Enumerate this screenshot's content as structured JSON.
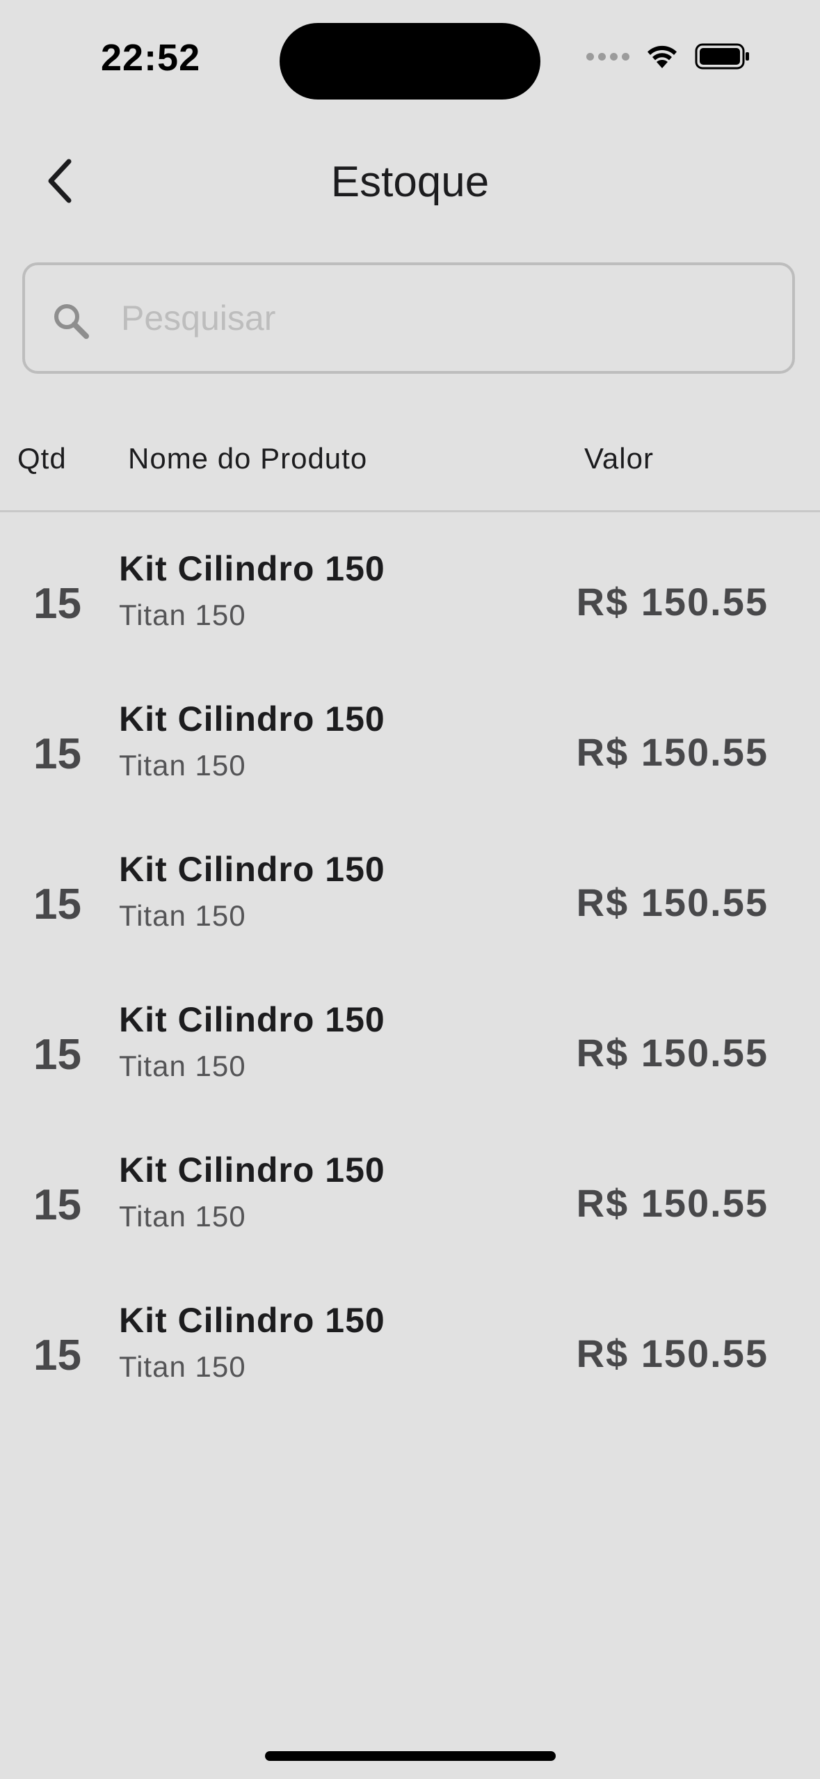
{
  "status_bar": {
    "time": "22:52",
    "icons": [
      "signal-icon",
      "wifi-icon",
      "battery-icon"
    ]
  },
  "nav": {
    "title": "Estoque",
    "back_icon": "chevron-left-icon"
  },
  "search": {
    "placeholder": "Pesquisar",
    "value": "",
    "icon": "search-icon"
  },
  "table": {
    "headers": {
      "qty": "Qtd",
      "name": "Nome do Produto",
      "value": "Valor"
    },
    "rows": [
      {
        "qty": "15",
        "name": "Kit Cilindro 150",
        "subtitle": "Titan 150",
        "value": "R$ 150.55"
      },
      {
        "qty": "15",
        "name": "Kit Cilindro 150",
        "subtitle": "Titan 150",
        "value": "R$ 150.55"
      },
      {
        "qty": "15",
        "name": "Kit Cilindro 150",
        "subtitle": "Titan 150",
        "value": "R$ 150.55"
      },
      {
        "qty": "15",
        "name": "Kit Cilindro 150",
        "subtitle": "Titan 150",
        "value": "R$ 150.55"
      },
      {
        "qty": "15",
        "name": "Kit Cilindro 150",
        "subtitle": "Titan 150",
        "value": "R$ 150.55"
      },
      {
        "qty": "15",
        "name": "Kit Cilindro 150",
        "subtitle": "Titan 150",
        "value": "R$ 150.55"
      }
    ]
  },
  "colors": {
    "background": "#e1e1e1",
    "primary_text": "#1c1c1e",
    "secondary_text": "#48484a",
    "border": "#bdbdbd"
  }
}
